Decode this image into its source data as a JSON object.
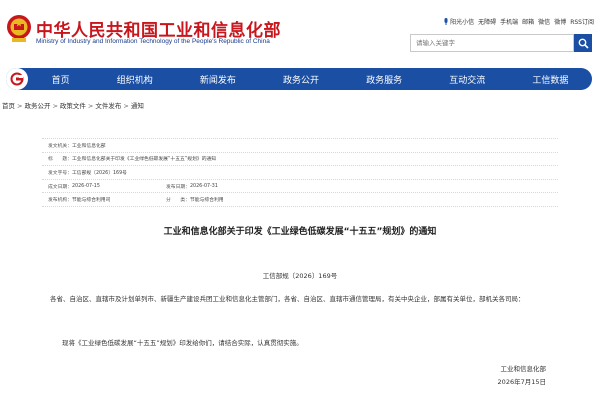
{
  "header": {
    "title_cn": "中华人民共和国工业和信息化部",
    "title_en": "Ministry of Industry and Information Technology of the People's Republic of China",
    "toplinks": [
      "阳光小信",
      "无障碍",
      "手机端",
      "邮箱",
      "微信",
      "微博",
      "RSS订阅"
    ],
    "search_placeholder": "请输入关键字"
  },
  "nav": {
    "items": [
      "首页",
      "组织机构",
      "新闻发布",
      "政务公开",
      "政务服务",
      "互动交流",
      "工信数据"
    ]
  },
  "breadcrumb": [
    "首页",
    "政务公开",
    "政策文件",
    "文件发布",
    "通知"
  ],
  "meta": {
    "issuer_label": "发文机关：",
    "issuer": "工业和信息化部",
    "title_label": "标　　题：",
    "title": "工业和信息化部关于印发《工业绿色低碳发展“十五五”规划》的通知",
    "docno_label": "发文字号：",
    "docno": "工信部规〔2026〕169号",
    "created_label": "成文日期：",
    "created": "2026-07-15",
    "published_label": "发布日期：",
    "published": "2026-07-31",
    "dept_label": "发布机构：",
    "dept": "节能与综合利用司",
    "category_label": "分　　类：",
    "category": "节能与综合利用"
  },
  "document": {
    "title": "工业和信息化部关于印发《工业绿色低碳发展“十五五”规划》的通知",
    "doc_no": "工信部规〔2026〕169号",
    "addressee": "各省、自治区、直辖市及计划单列市、新疆生产建设兵团工业和信息化主管部门，各省、自治区、直辖市通信管理局，有关中央企业，部属有关单位，部机关各司局：",
    "body": "现将《工业绿色低碳发展“十五五”规划》印发给你们，请结合实际，认真贯彻实施。",
    "signature": "工业和信息化部",
    "date": "2026年7月15日"
  },
  "colors": {
    "brand_red": "#c8161d",
    "nav_blue": "#1b4fa3"
  }
}
